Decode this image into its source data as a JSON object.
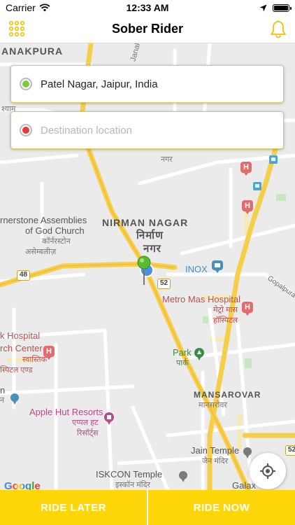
{
  "status_bar": {
    "carrier": "Carrier",
    "time": "12:33 AM"
  },
  "nav": {
    "title": "Sober Rider",
    "menu_icon": "grid-dots-icon",
    "notification_icon": "bell-icon"
  },
  "pickup": {
    "value": "Patel Nagar, Jaipur, India",
    "dot_color": "#7ac943"
  },
  "destination": {
    "placeholder": "Destination location",
    "dot_color": "#e53935"
  },
  "map": {
    "labels": {
      "anakpura": "ANAKPURA",
      "janak": "Janak",
      "nirman_nagar": "NIRMAN NAGAR",
      "nirman_nagar_hi_1": "निर्माण",
      "nirman_nagar_hi_2": "नगर",
      "nagar": "नगर",
      "cornerstone_1": "rnerstone Assemblies",
      "cornerstone_2": "of God Church",
      "cornerstone_hi_1": "कॉर्नरस्टोन",
      "cornerstone_hi_2": "असेम्बलीज़",
      "inox": "INOX",
      "metro_mas": "Metro Mas Hospital",
      "metro_mas_hi_1": "मेट्रो मास",
      "metro_mas_hi_2": "हॉस्पिटल",
      "gopalpura": "Gopalpura Ro",
      "k_hospital": "k Hospital",
      "rch_center": "rch Center",
      "k_hospital_hi_1": "स्वास्तिक",
      "k_hospital_hi_2": "स्पिटल एण्ड",
      "park": "Park",
      "park_hi": "पार्क",
      "mansarovar": "MANSAROVAR",
      "mansarovar_hi": "मानसरोवर",
      "apple_hut": "Apple Hut Resorts",
      "apple_hut_hi_1": "एप्पल हट",
      "apple_hut_hi_2": "रिसॉर्ट्स",
      "jain_temple": "Jain Temple",
      "jain_temple_hi": "जैन मंदिर",
      "iskcon": "ISKCON Temple",
      "iskcon_hi": "इस्कॉन मंदिर",
      "galaxy": "Galax",
      "left_n": "n",
      "left_hi": "न",
      "shyam_hi": "श्याम",
      "top_hi": "नगर",
      "google": "Google"
    },
    "road_badges": {
      "r48": "48",
      "r52": "52",
      "r52b": "52"
    }
  },
  "buttons": {
    "ride_later": "RIDE LATER",
    "ride_now": "RIDE NOW"
  },
  "colors": {
    "accent": "#ffd60a",
    "nav_icon": "#f2c200"
  }
}
